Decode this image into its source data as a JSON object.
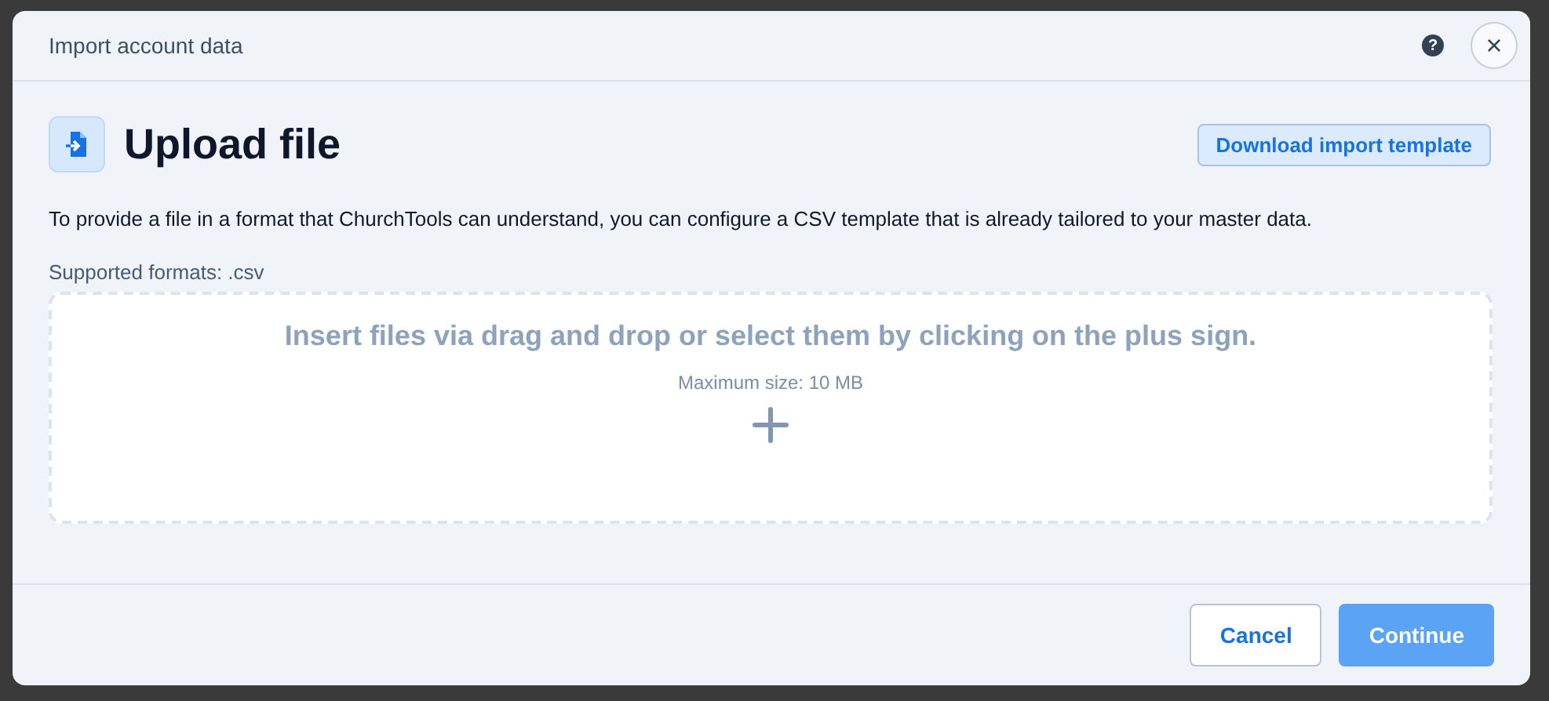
{
  "dialog": {
    "title": "Import account data",
    "help_label": "?",
    "close_label": "×"
  },
  "step": {
    "title": "Upload file",
    "template_button": "Download import template",
    "description": "To provide a file in a format that ChurchTools can understand, you can configure a CSV template that is already tailored to your master data.",
    "formats": "Supported formats: .csv"
  },
  "dropzone": {
    "instruction": "Insert files via drag and drop or select them by clicking on the plus sign.",
    "max_size": "Maximum size: 10 MB"
  },
  "buttons": [
    {
      "label": "Cancel",
      "kind": "secondary",
      "disabled": false
    },
    {
      "label": "Continue",
      "kind": "primary",
      "disabled": true
    }
  ]
}
